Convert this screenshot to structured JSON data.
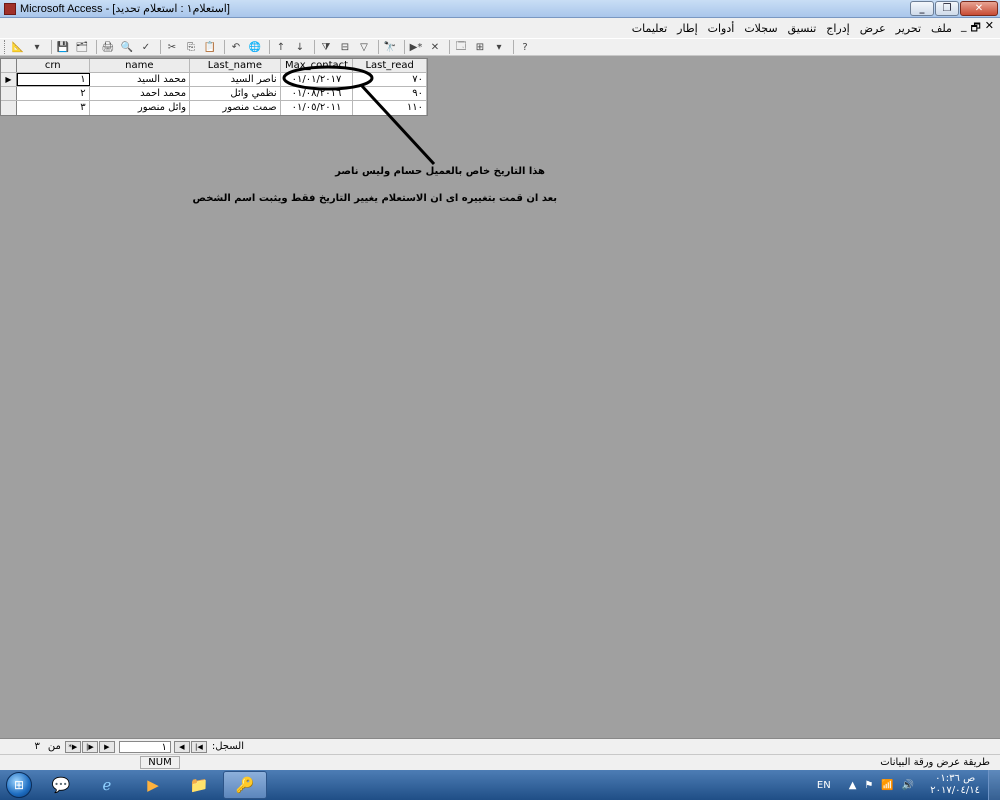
{
  "window": {
    "title": "Microsoft Access - [استعلام١ : استعلام تحديد]"
  },
  "menu": {
    "items": [
      "ملف",
      "تحرير",
      "عرض",
      "إدراج",
      "تنسيق",
      "سجلات",
      "أدوات",
      "إطار",
      "تعليمات"
    ]
  },
  "datasheet": {
    "columns": [
      "crn",
      "name",
      "Last_name",
      "Max_contact",
      "Last_read"
    ],
    "rows": [
      {
        "crn": "١",
        "name": "محمد السيد",
        "last_name": "ناصر السيد",
        "max_contact": "٠١/٠١/٢٠١٧",
        "last_read": "٧٠"
      },
      {
        "crn": "٢",
        "name": "محمد احمد",
        "last_name": "نظمي وائل",
        "max_contact": "٠١/٠٨/٢٠١٦",
        "last_read": "٩٠"
      },
      {
        "crn": "٣",
        "name": "وائل منصور",
        "last_name": "صمت منصور",
        "max_contact": "٠١/٠٥/٢٠١١",
        "last_read": "١١٠"
      }
    ]
  },
  "annotation": {
    "line1": "هذا التاريخ خاص بالعميل حسام وليس ناصر",
    "line2": "بعد ان قمت بتغييره اى ان الاستعلام يغيير التاريخ فقط ويثبت اسم الشخص"
  },
  "record_nav": {
    "label": "السجل:",
    "current": "١",
    "of_label": "من",
    "total": "٣"
  },
  "status": {
    "text": "طريقة عرض ورقة البيانات",
    "num": "NUM"
  },
  "taskbar": {
    "lang": "EN",
    "time": "ص ٠١:٣٦",
    "date": "٢٠١٧/٠٤/١٤"
  }
}
